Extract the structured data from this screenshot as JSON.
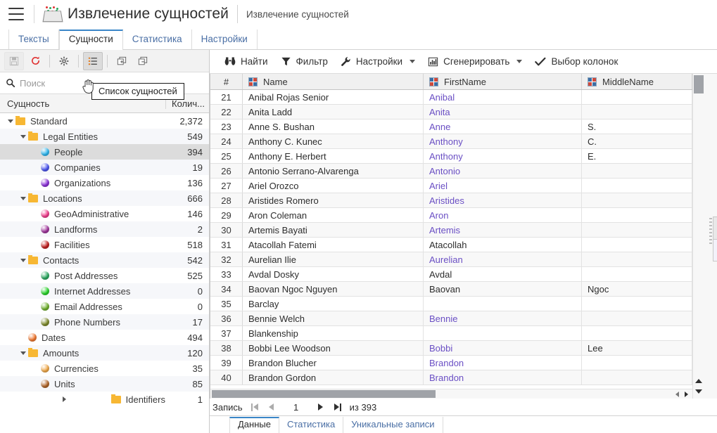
{
  "header": {
    "menu_icon": "hamburger-icon",
    "app_icon": "entity-extraction-icon",
    "title": "Извлечение сущностей",
    "subtitle": "Извлечение сущностей"
  },
  "main_tabs": [
    {
      "label": "Тексты",
      "active": false
    },
    {
      "label": "Сущности",
      "active": true
    },
    {
      "label": "Статистика",
      "active": false
    },
    {
      "label": "Настройки",
      "active": false
    }
  ],
  "sidebar": {
    "toolbar": [
      {
        "name": "save-button",
        "icon": "floppy-disk-icon",
        "disabled": true
      },
      {
        "name": "refresh-button",
        "icon": "refresh-icon",
        "disabled": false
      },
      {
        "name": "settings-button",
        "icon": "gear-icon",
        "disabled": false
      },
      {
        "name": "entity-list-button",
        "icon": "list-icon",
        "disabled": false,
        "active": true
      },
      {
        "name": "expand-all-button",
        "icon": "expand-windows-icon",
        "disabled": false
      },
      {
        "name": "collapse-all-button",
        "icon": "collapse-windows-icon",
        "disabled": false
      }
    ],
    "tooltip": "Список сущностей",
    "search_placeholder": "Поиск",
    "search_value": "",
    "columns": [
      "Сущность",
      "Колич..."
    ],
    "tree": [
      {
        "label": "Standard",
        "count": "2,372",
        "level": 0,
        "type": "folder",
        "expanded": true,
        "selected": false
      },
      {
        "label": "Legal Entities",
        "count": "549",
        "level": 1,
        "type": "folder",
        "expanded": true,
        "selected": false
      },
      {
        "label": "People",
        "count": "394",
        "level": 2,
        "type": "dot",
        "color": "#2fb7f0",
        "selected": true
      },
      {
        "label": "Companies",
        "count": "19",
        "level": 2,
        "type": "dot",
        "color": "#4a54f0",
        "selected": false
      },
      {
        "label": "Organizations",
        "count": "136",
        "level": 2,
        "type": "dot",
        "color": "#8b30d8",
        "selected": false
      },
      {
        "label": "Locations",
        "count": "666",
        "level": 1,
        "type": "folder",
        "expanded": true,
        "selected": false
      },
      {
        "label": "GeoAdministrative",
        "count": "146",
        "level": 2,
        "type": "dot",
        "color": "#f03c8c",
        "selected": false
      },
      {
        "label": "Landforms",
        "count": "2",
        "level": 2,
        "type": "dot",
        "color": "#a0359c",
        "selected": false
      },
      {
        "label": "Facilities",
        "count": "518",
        "level": 2,
        "type": "dot",
        "color": "#c01f1f",
        "selected": false
      },
      {
        "label": "Contacts",
        "count": "542",
        "level": 1,
        "type": "folder",
        "expanded": true,
        "selected": false
      },
      {
        "label": "Post Addresses",
        "count": "525",
        "level": 2,
        "type": "dot",
        "color": "#2aa85f",
        "selected": false
      },
      {
        "label": "Internet Addresses",
        "count": "0",
        "level": 2,
        "type": "dot",
        "color": "#29d42a",
        "selected": false
      },
      {
        "label": "Email Addresses",
        "count": "0",
        "level": 2,
        "type": "dot",
        "color": "#6fb02c",
        "selected": false
      },
      {
        "label": "Phone Numbers",
        "count": "17",
        "level": 2,
        "type": "dot",
        "color": "#7d8a2c",
        "selected": false
      },
      {
        "label": "Dates",
        "count": "494",
        "level": 1,
        "type": "dot",
        "color": "#f07830",
        "selected": false
      },
      {
        "label": "Amounts",
        "count": "120",
        "level": 1,
        "type": "folder",
        "expanded": true,
        "selected": false
      },
      {
        "label": "Currencies",
        "count": "35",
        "level": 2,
        "type": "dot",
        "color": "#f0a848",
        "selected": false
      },
      {
        "label": "Units",
        "count": "85",
        "level": 2,
        "type": "dot",
        "color": "#b06428",
        "selected": false
      },
      {
        "label": "Identifiers",
        "count": "1",
        "level": 1,
        "type": "folder",
        "expanded": false,
        "selected": false
      }
    ]
  },
  "grid_toolbar": [
    {
      "label": "Найти",
      "icon": "binoculars-icon",
      "dropdown": false
    },
    {
      "label": "Фильтр",
      "icon": "funnel-icon",
      "dropdown": false
    },
    {
      "label": "Настройки",
      "icon": "wrench-icon",
      "dropdown": true
    },
    {
      "label": "Сгенерировать",
      "icon": "bar-chart-icon",
      "dropdown": true
    },
    {
      "label": "Выбор колонок",
      "icon": "check-icon",
      "dropdown": false
    }
  ],
  "grid": {
    "columns": [
      {
        "label": "#",
        "type": "row-number"
      },
      {
        "label": "Name",
        "type": "text"
      },
      {
        "label": "FirstName",
        "type": "text"
      },
      {
        "label": "MiddleName",
        "type": "text"
      }
    ],
    "rows": [
      {
        "num": "21",
        "name": "Anibal Rojas Senior",
        "first": "Anibal",
        "first_link": true,
        "middle": ""
      },
      {
        "num": "22",
        "name": "Anita Ladd",
        "first": "Anita",
        "first_link": true,
        "middle": ""
      },
      {
        "num": "23",
        "name": "Anne S. Bushan",
        "first": "Anne",
        "first_link": true,
        "middle": "S."
      },
      {
        "num": "24",
        "name": "Anthony C. Kunec",
        "first": "Anthony",
        "first_link": true,
        "middle": "C."
      },
      {
        "num": "25",
        "name": "Anthony E. Herbert",
        "first": "Anthony",
        "first_link": true,
        "middle": "E."
      },
      {
        "num": "26",
        "name": "Antonio Serrano-Alvarenga",
        "first": "Antonio",
        "first_link": true,
        "middle": ""
      },
      {
        "num": "27",
        "name": "Ariel Orozco",
        "first": "Ariel",
        "first_link": true,
        "middle": ""
      },
      {
        "num": "28",
        "name": "Aristides Romero",
        "first": "Aristides",
        "first_link": true,
        "middle": ""
      },
      {
        "num": "29",
        "name": "Aron Coleman",
        "first": "Aron",
        "first_link": true,
        "middle": ""
      },
      {
        "num": "30",
        "name": "Artemis Bayati",
        "first": "Artemis",
        "first_link": true,
        "middle": ""
      },
      {
        "num": "31",
        "name": "Atacollah Fatemi",
        "first": "Atacollah",
        "first_link": false,
        "middle": ""
      },
      {
        "num": "32",
        "name": "Aurelian Ilie",
        "first": "Aurelian",
        "first_link": true,
        "middle": ""
      },
      {
        "num": "33",
        "name": "Avdal Dosky",
        "first": "Avdal",
        "first_link": false,
        "middle": ""
      },
      {
        "num": "34",
        "name": "Baovan Ngoc Nguyen",
        "first": "Baovan",
        "first_link": false,
        "middle": "Ngoc"
      },
      {
        "num": "35",
        "name": "Barclay",
        "first": "",
        "first_link": false,
        "middle": ""
      },
      {
        "num": "36",
        "name": "Bennie Welch",
        "first": "Bennie",
        "first_link": true,
        "middle": ""
      },
      {
        "num": "37",
        "name": "Blankenship",
        "first": "",
        "first_link": false,
        "middle": ""
      },
      {
        "num": "38",
        "name": "Bobbi Lee Woodson",
        "first": "Bobbi",
        "first_link": true,
        "middle": "Lee"
      },
      {
        "num": "39",
        "name": "Brandon Blucher",
        "first": "Brandon",
        "first_link": true,
        "middle": ""
      },
      {
        "num": "40",
        "name": "Brandon Gordon",
        "first": "Brandon",
        "first_link": true,
        "middle": ""
      }
    ]
  },
  "pager": {
    "label": "Запись",
    "first_icon": "first-page-icon",
    "prev_icon": "prev-page-icon",
    "current": "1",
    "next_icon": "next-page-icon",
    "last_icon": "last-page-icon",
    "of_text": "из 393"
  },
  "bottom_tabs": [
    {
      "label": "Данные",
      "active": true
    },
    {
      "label": "Статистика",
      "active": false
    },
    {
      "label": "Уникальные записи",
      "active": false
    }
  ],
  "colors": {
    "accent": "#3a86c8",
    "link": "#4a6fa5",
    "cell_link": "#6a4fc4",
    "selection": "#dcdcdc",
    "folder": "#f7b733",
    "refresh": "#e03131"
  }
}
